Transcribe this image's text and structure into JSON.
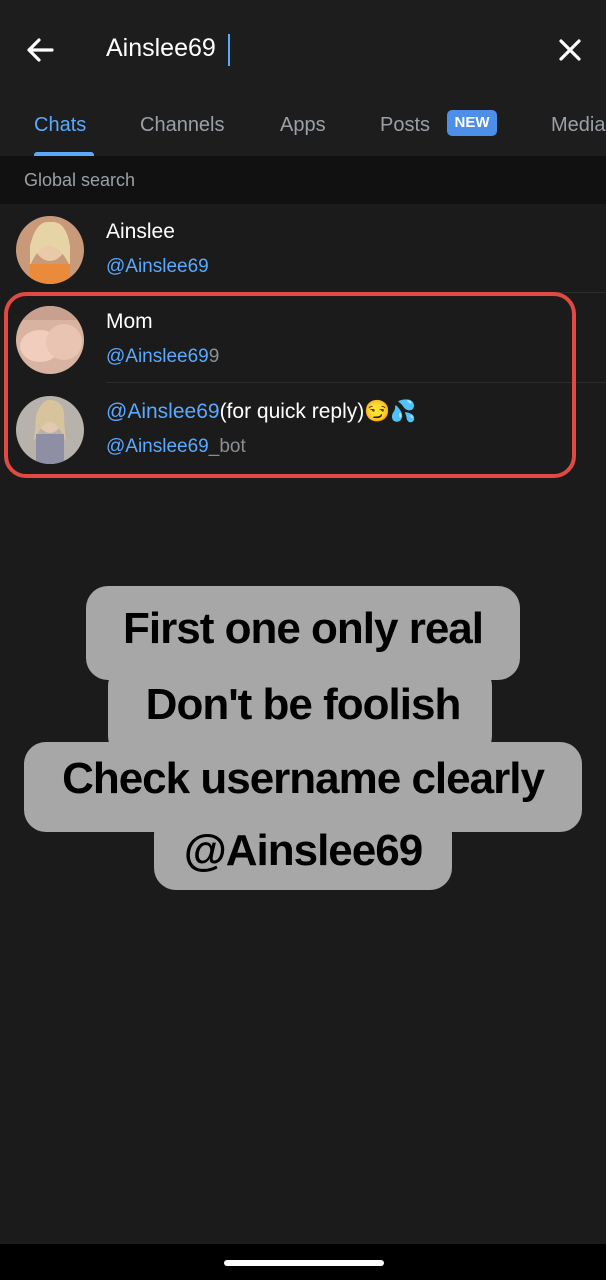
{
  "search": {
    "query": "Ainslee69"
  },
  "tabs": [
    {
      "label": "Chats"
    },
    {
      "label": "Channels"
    },
    {
      "label": "Apps"
    },
    {
      "label": "Posts"
    },
    {
      "label": "Media"
    }
  ],
  "posts_badge": "NEW",
  "section": {
    "title": "Global search"
  },
  "results": [
    {
      "name": "Ainslee",
      "username": "@Ainslee69",
      "username_extra": ""
    },
    {
      "name": "Mom",
      "username": "@Ainslee69",
      "username_extra": "9"
    },
    {
      "name_highlight": "@Ainslee69",
      "name_rest": "(for quick reply)😏💦",
      "username": "@Ainslee69",
      "username_extra": "_bot"
    }
  ],
  "overlay_text": [
    "First one only real",
    "Don't be foolish",
    "Check username clearly",
    "@Ainslee69"
  ],
  "colors": {
    "accent": "#5aa9ff",
    "highlight_border": "#e04a42",
    "background": "#1b1b1b"
  }
}
